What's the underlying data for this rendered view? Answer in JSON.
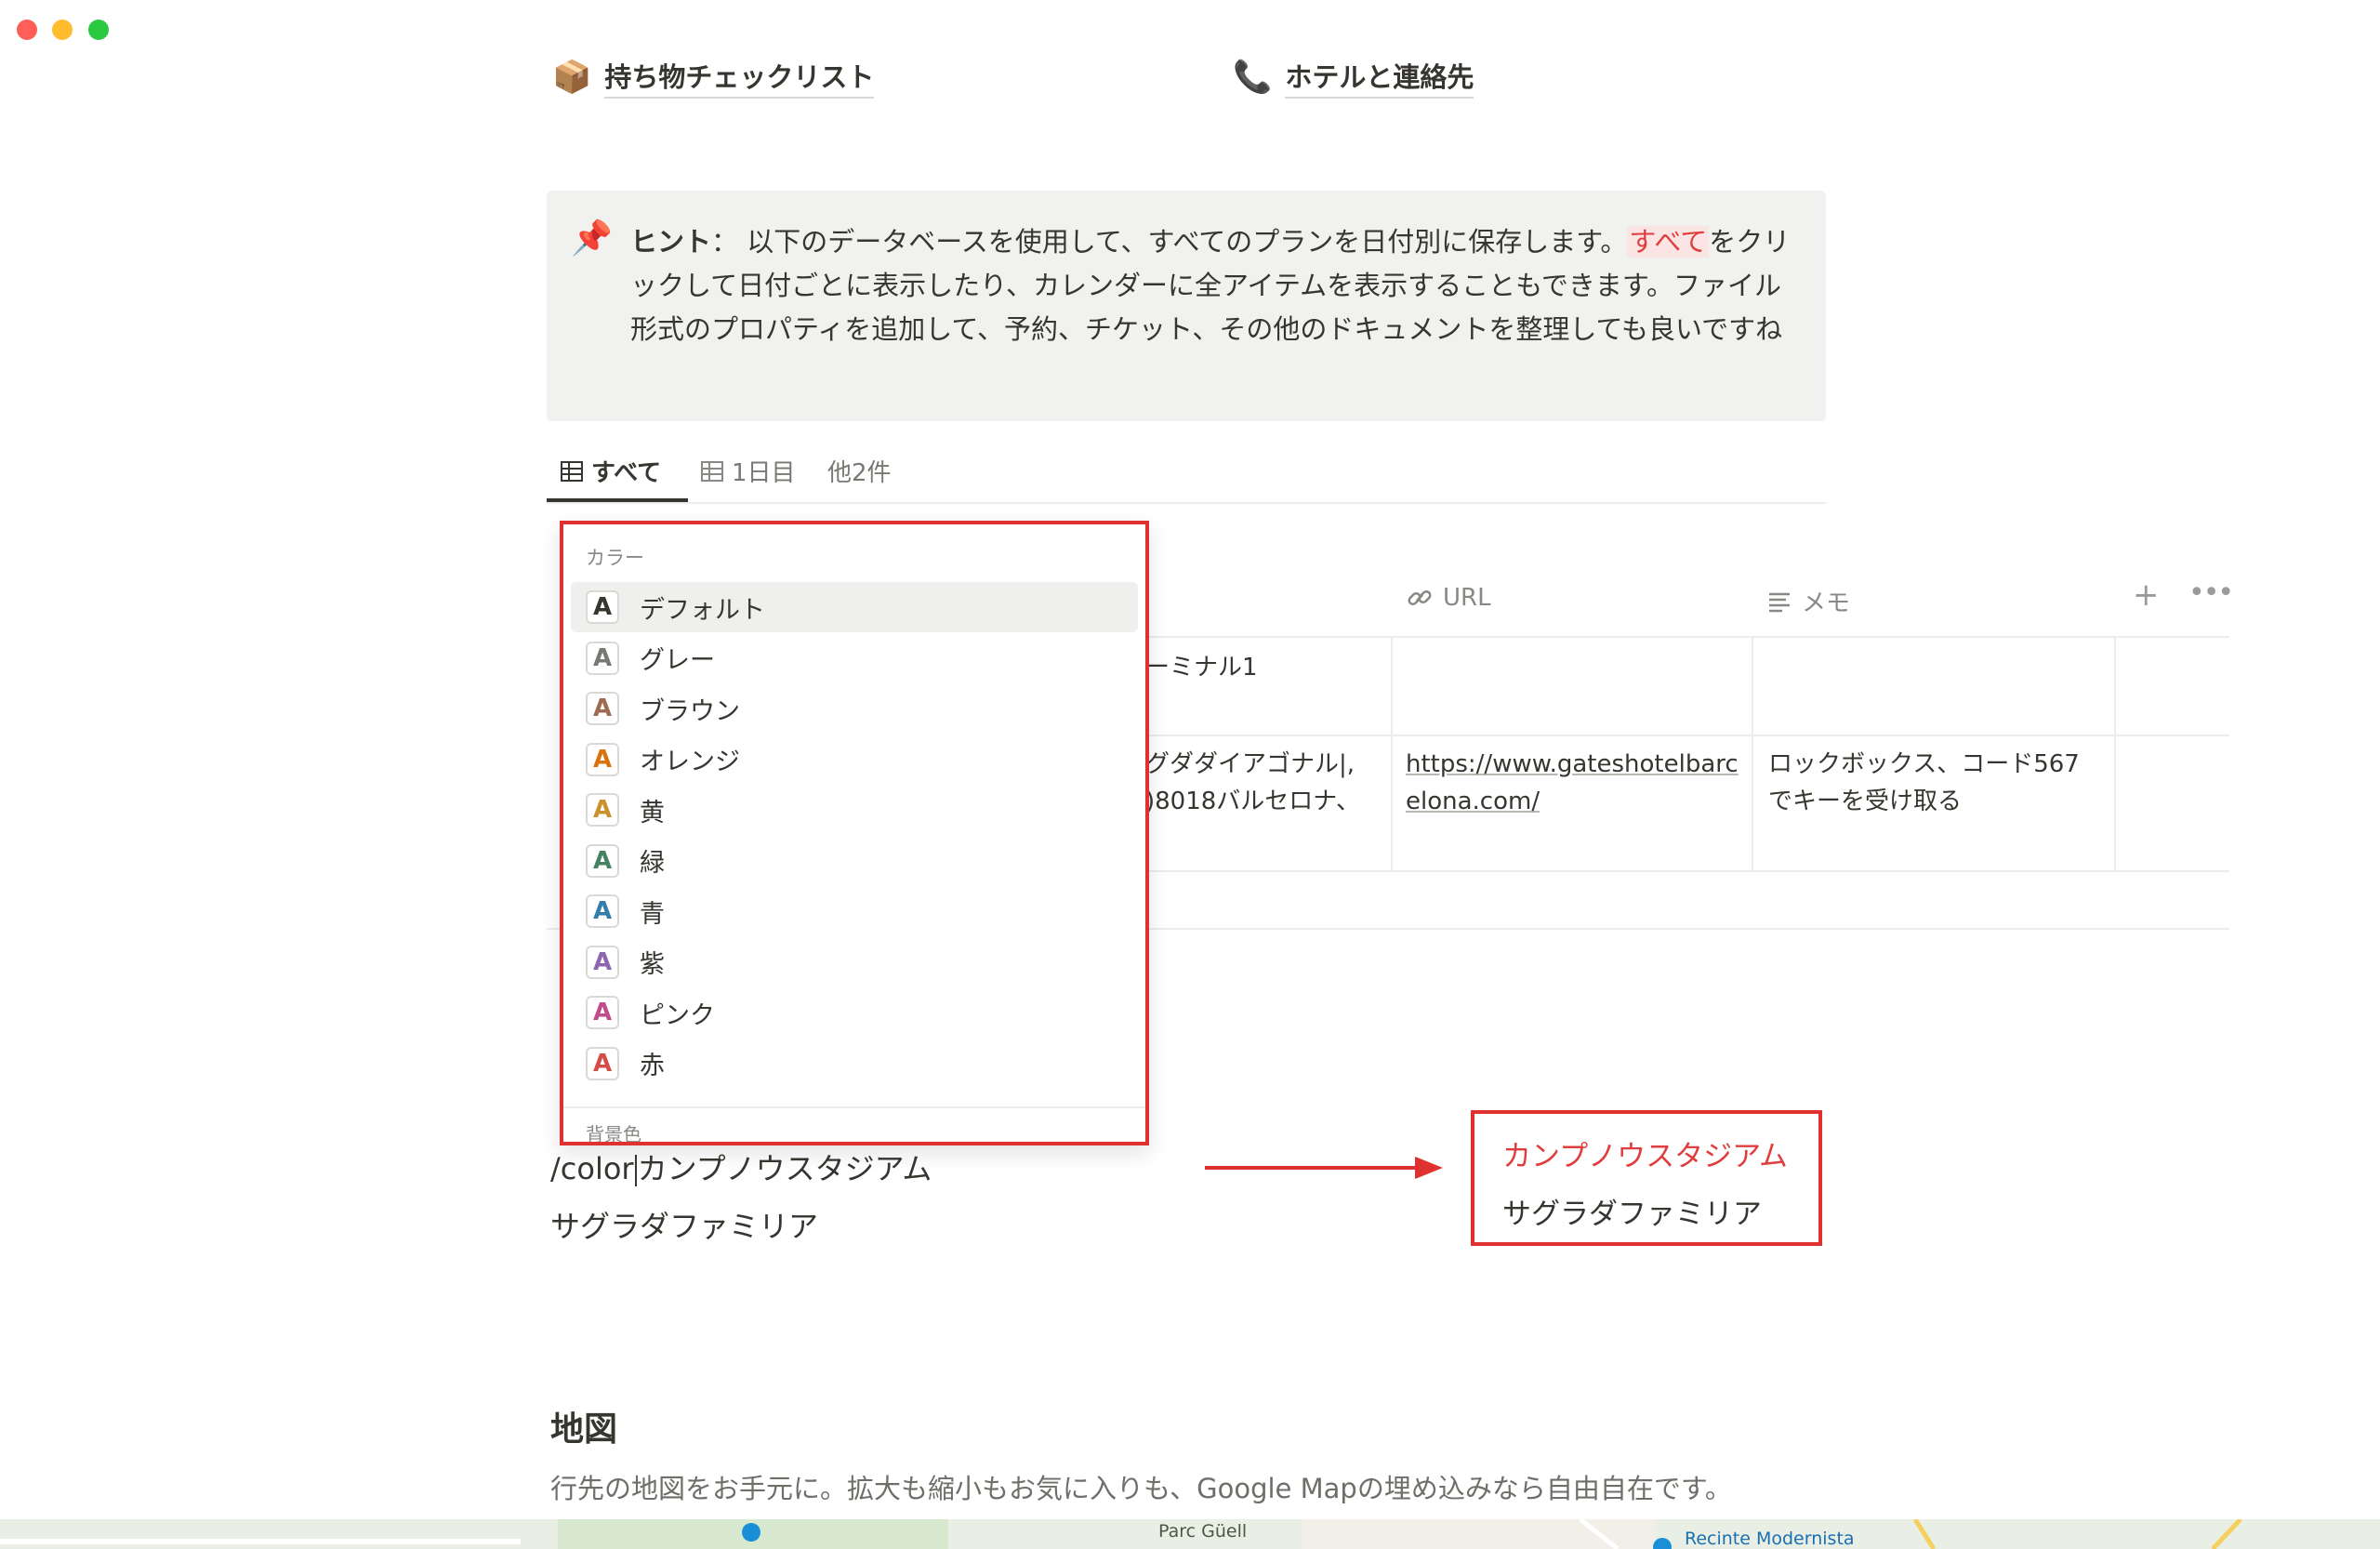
{
  "top_links": [
    {
      "icon": "📦",
      "label": "持ち物チェックリスト"
    },
    {
      "icon": "📞",
      "label": "ホテルと連絡先"
    }
  ],
  "callout": {
    "icon": "📌",
    "bold": "ヒント",
    "sep": "：",
    "text1": "以下のデータベースを使用して、すべてのプランを日付別に保存します。",
    "highlight": "すべて",
    "text2": "をクリックして日付ごとに表示したり、カレンダーに全アイテムを表示することもできます。ファイル形式のプロパティを追加して、予約、チケット、その他のドキュメントを整理しても良いですね"
  },
  "tabs": [
    {
      "label": "すべて",
      "active": true
    },
    {
      "label": "1日目",
      "active": false
    },
    {
      "label": "他2件",
      "active": false
    }
  ],
  "table": {
    "headers": {
      "url": "URL",
      "memo": "メモ"
    },
    "rows": [
      {
        "place": "ーミナル1",
        "url": "",
        "memo": ""
      },
      {
        "place_line1": "グダダイアゴナル|,",
        "place_line2": ")8018バルセロナ、",
        "url_line1": "https://www.gateshotelbarc",
        "url_line2": "elona.com/",
        "memo_line1": "ロックボックス、コード567",
        "memo_line2": "でキーを受け取る"
      }
    ]
  },
  "color_menu": {
    "title": "カラー",
    "items": [
      {
        "label": "デフォルト",
        "color": "#37352f",
        "selected": true
      },
      {
        "label": "グレー",
        "color": "#787774",
        "selected": false
      },
      {
        "label": "ブラウン",
        "color": "#9f6b53",
        "selected": false
      },
      {
        "label": "オレンジ",
        "color": "#d9730d",
        "selected": false
      },
      {
        "label": "黄",
        "color": "#cb912f",
        "selected": false
      },
      {
        "label": "緑",
        "color": "#448361",
        "selected": false
      },
      {
        "label": "青",
        "color": "#337ea9",
        "selected": false
      },
      {
        "label": "紫",
        "color": "#9065b0",
        "selected": false
      },
      {
        "label": "ピンク",
        "color": "#c14c8a",
        "selected": false
      },
      {
        "label": "赤",
        "color": "#d44c47",
        "selected": false
      }
    ],
    "next_section_cut": "背景色",
    "swatch_letter": "A"
  },
  "editor": {
    "command": "/color",
    "line1_rest": "カンプノウスタジアム",
    "line2": "サグラダファミリア"
  },
  "result_box": {
    "line1": "カンプノウスタジアム",
    "line1_color": "#e03e3e",
    "line2": "サグラダファミリア"
  },
  "map_section": {
    "heading": "地図",
    "description": "行先の地図をお手元に。拡大も縮小もお気に入りも、Google Mapの埋め込みなら自由自在です。",
    "map_labels": [
      "Parc Güell",
      "Recinte Modernista"
    ]
  }
}
